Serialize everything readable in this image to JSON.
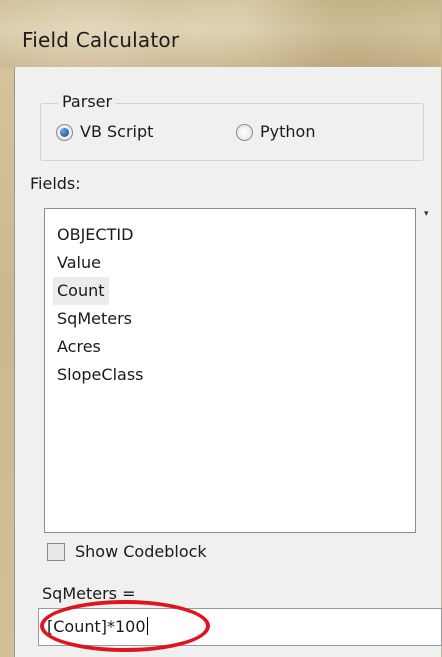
{
  "window": {
    "title": "Field Calculator"
  },
  "parser": {
    "label": "Parser",
    "options": [
      {
        "label": "VB Script",
        "selected": true
      },
      {
        "label": "Python",
        "selected": false
      }
    ]
  },
  "fields": {
    "label": "Fields:",
    "items": [
      "OBJECTID",
      "Value",
      "Count",
      "SqMeters",
      "Acres",
      "SlopeClass"
    ],
    "highlighted": "Count"
  },
  "codeblock": {
    "label": "Show Codeblock",
    "checked": false
  },
  "expression": {
    "target_label": "SqMeters =",
    "value": "[Count]*100"
  },
  "colors": {
    "annotation": "#e0141e",
    "radio_selected": "#1f5fb0"
  }
}
